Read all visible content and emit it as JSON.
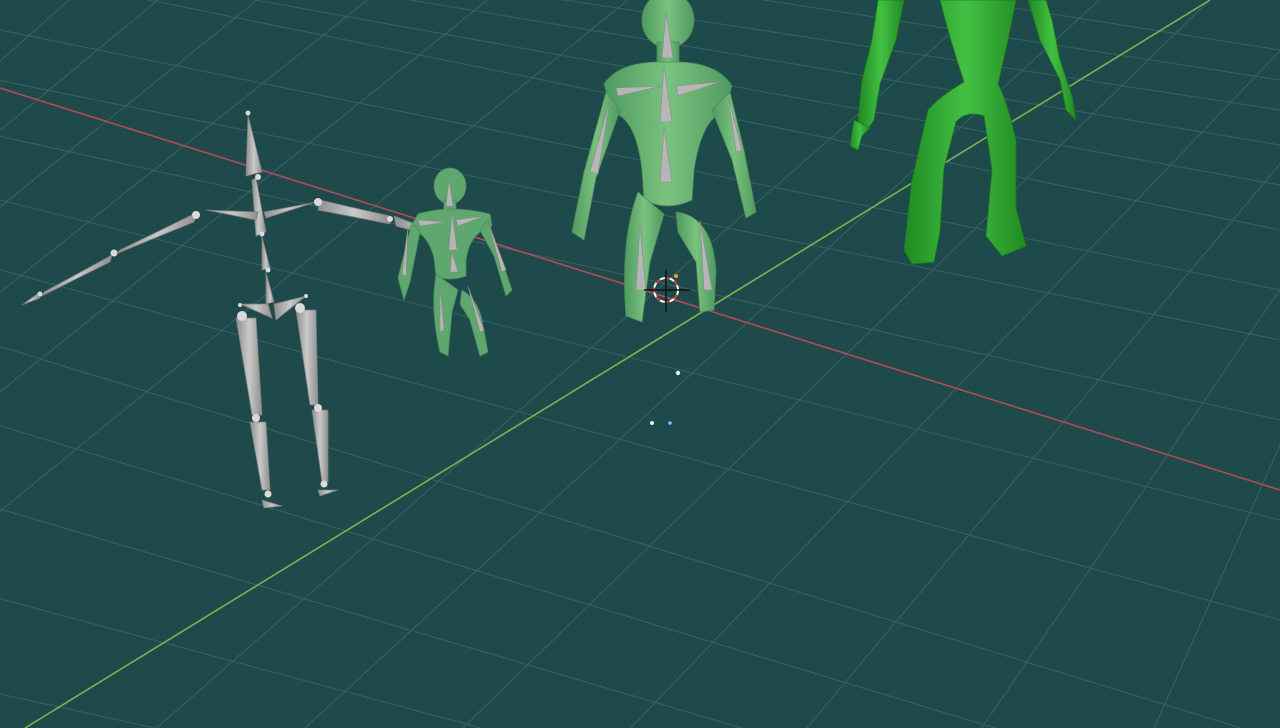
{
  "viewport": {
    "background_color": "#1f4a4c",
    "grid_color": "#3f6668",
    "x_axis_color": "#b34a55",
    "y_axis_color": "#7fb24a"
  },
  "objects": {
    "armature_color": "#a9aaa9",
    "mesh_small_color": "#5ea86f",
    "mesh_medium_color": "#5fae6d",
    "mesh_large_color": "#2fa72f",
    "cursor_icon": "3d-cursor-icon",
    "light_point_color": "#d7f0ff"
  }
}
